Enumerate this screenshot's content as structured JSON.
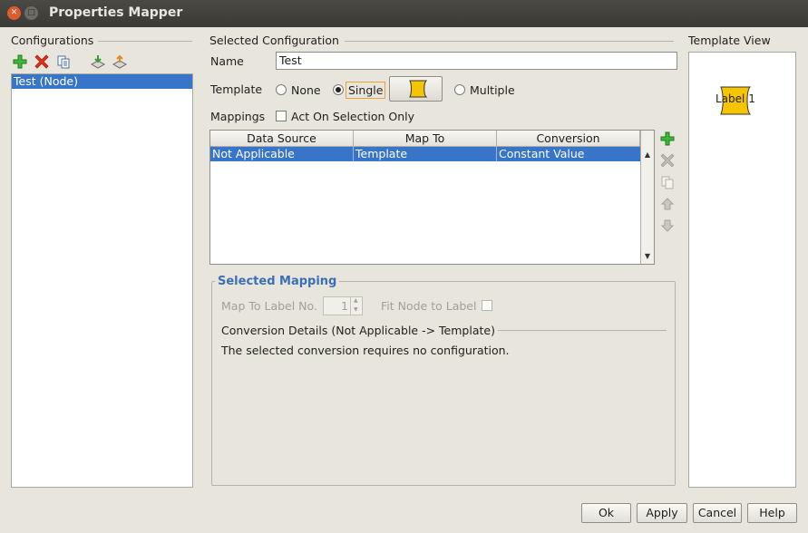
{
  "window": {
    "title": "Properties Mapper"
  },
  "configurations": {
    "label": "Configurations",
    "toolbar": [
      "add-icon",
      "delete-icon",
      "copy-icon",
      "import-icon",
      "export-icon"
    ],
    "items": [
      "Test (Node)"
    ]
  },
  "selected_configuration": {
    "label": "Selected Configuration",
    "name_label": "Name",
    "name_value": "Test",
    "template_label": "Template",
    "template_options": {
      "none": "None",
      "single": "Single",
      "multiple": "Multiple"
    },
    "template_selected": "Single",
    "mappings_label": "Mappings",
    "act_on_selection_label": "Act On Selection Only",
    "act_on_selection_checked": false
  },
  "mappings_table": {
    "columns": [
      "Data Source",
      "Map To",
      "Conversion"
    ],
    "rows": [
      {
        "data_source": "Not Applicable",
        "map_to": "Template",
        "conversion": "Constant Value"
      }
    ]
  },
  "selected_mapping": {
    "title": "Selected Mapping",
    "map_to_label_no": "Map To Label No.",
    "map_to_label_value": "1",
    "fit_node_to_label": "Fit Node to Label",
    "conversion_details_label": "Conversion Details (Not Applicable -> Template)",
    "conversion_message": "The selected conversion requires no configuration."
  },
  "template_view": {
    "label": "Template View",
    "node_label": "Label 1",
    "node_color": "#f6c400"
  },
  "buttons": {
    "ok": "Ok",
    "apply": "Apply",
    "cancel": "Cancel",
    "help": "Help"
  },
  "colors": {
    "selection": "#3874c8",
    "group_title": "#3a6fb8",
    "window_bg": "#e8e6dc"
  }
}
